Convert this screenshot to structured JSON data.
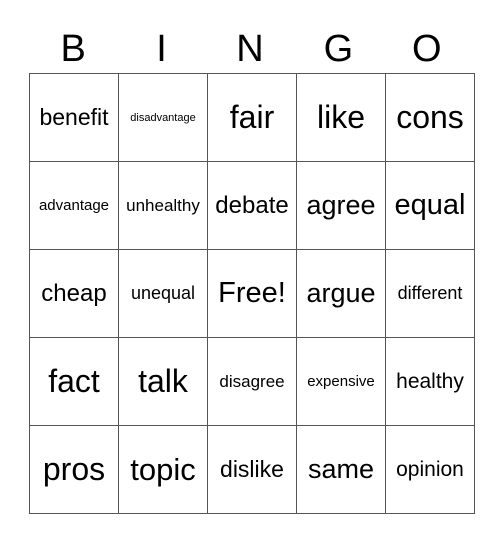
{
  "header": {
    "letters": [
      "B",
      "I",
      "N",
      "G",
      "O"
    ]
  },
  "card": {
    "rows": [
      [
        "benefit",
        "disadvantage",
        "fair",
        "like",
        "cons"
      ],
      [
        "advantage",
        "unhealthy",
        "debate",
        "agree",
        "equal"
      ],
      [
        "cheap",
        "unequal",
        "Free!",
        "argue",
        "different"
      ],
      [
        "fact",
        "talk",
        "disagree",
        "expensive",
        "healthy"
      ],
      [
        "pros",
        "topic",
        "dislike",
        "same",
        "opinion"
      ]
    ],
    "free_space": "Free!"
  }
}
